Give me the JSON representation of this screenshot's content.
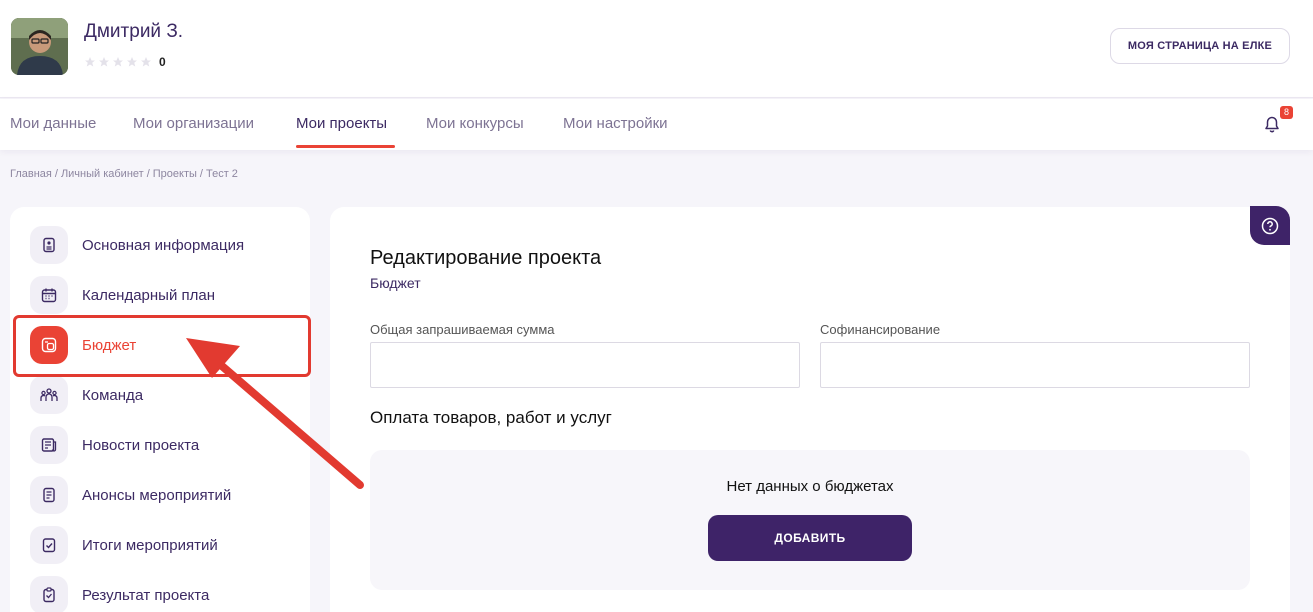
{
  "user": {
    "name": "Дмитрий З.",
    "rating_value": "0",
    "stars_filled": 0,
    "stars_total": 5
  },
  "header": {
    "my_page_button": "МОЯ СТРАНИЦА НА ЕЛКЕ"
  },
  "nav": {
    "tabs": [
      {
        "label": "Мои данные"
      },
      {
        "label": "Мои организации"
      },
      {
        "label": "Мои проекты"
      },
      {
        "label": "Мои конкурсы"
      },
      {
        "label": "Мои настройки"
      }
    ],
    "active_tab": "Мои проекты",
    "notifications_count": "8"
  },
  "breadcrumb": [
    "Главная",
    "Личный кабинет",
    "Проекты",
    "Тест 2"
  ],
  "sidebar": {
    "items": [
      {
        "label": "Основная информация",
        "icon": "document-icon"
      },
      {
        "label": "Календарный план",
        "icon": "calendar-icon"
      },
      {
        "label": "Бюджет",
        "icon": "budget-icon"
      },
      {
        "label": "Команда",
        "icon": "team-icon"
      },
      {
        "label": "Новости проекта",
        "icon": "news-icon"
      },
      {
        "label": "Анонсы мероприятий",
        "icon": "announcement-icon"
      },
      {
        "label": "Итоги мероприятий",
        "icon": "checklist-icon"
      },
      {
        "label": "Результат проекта",
        "icon": "result-icon"
      }
    ],
    "active_item": "Бюджет"
  },
  "main": {
    "title": "Редактирование проекта",
    "subtitle": "Бюджет",
    "fields": {
      "requested_sum_label": "Общая запрашиваемая сумма",
      "requested_sum_value": "",
      "cofinancing_label": "Софинансирование",
      "cofinancing_value": ""
    },
    "section_title": "Оплата товаров, работ и услуг",
    "empty_message": "Нет данных о бюджетах",
    "add_button": "ДОБАВИТЬ"
  },
  "colors": {
    "accent_red": "#ea4335",
    "brand_purple": "#3e2368",
    "text_purple": "#3c2a63"
  }
}
